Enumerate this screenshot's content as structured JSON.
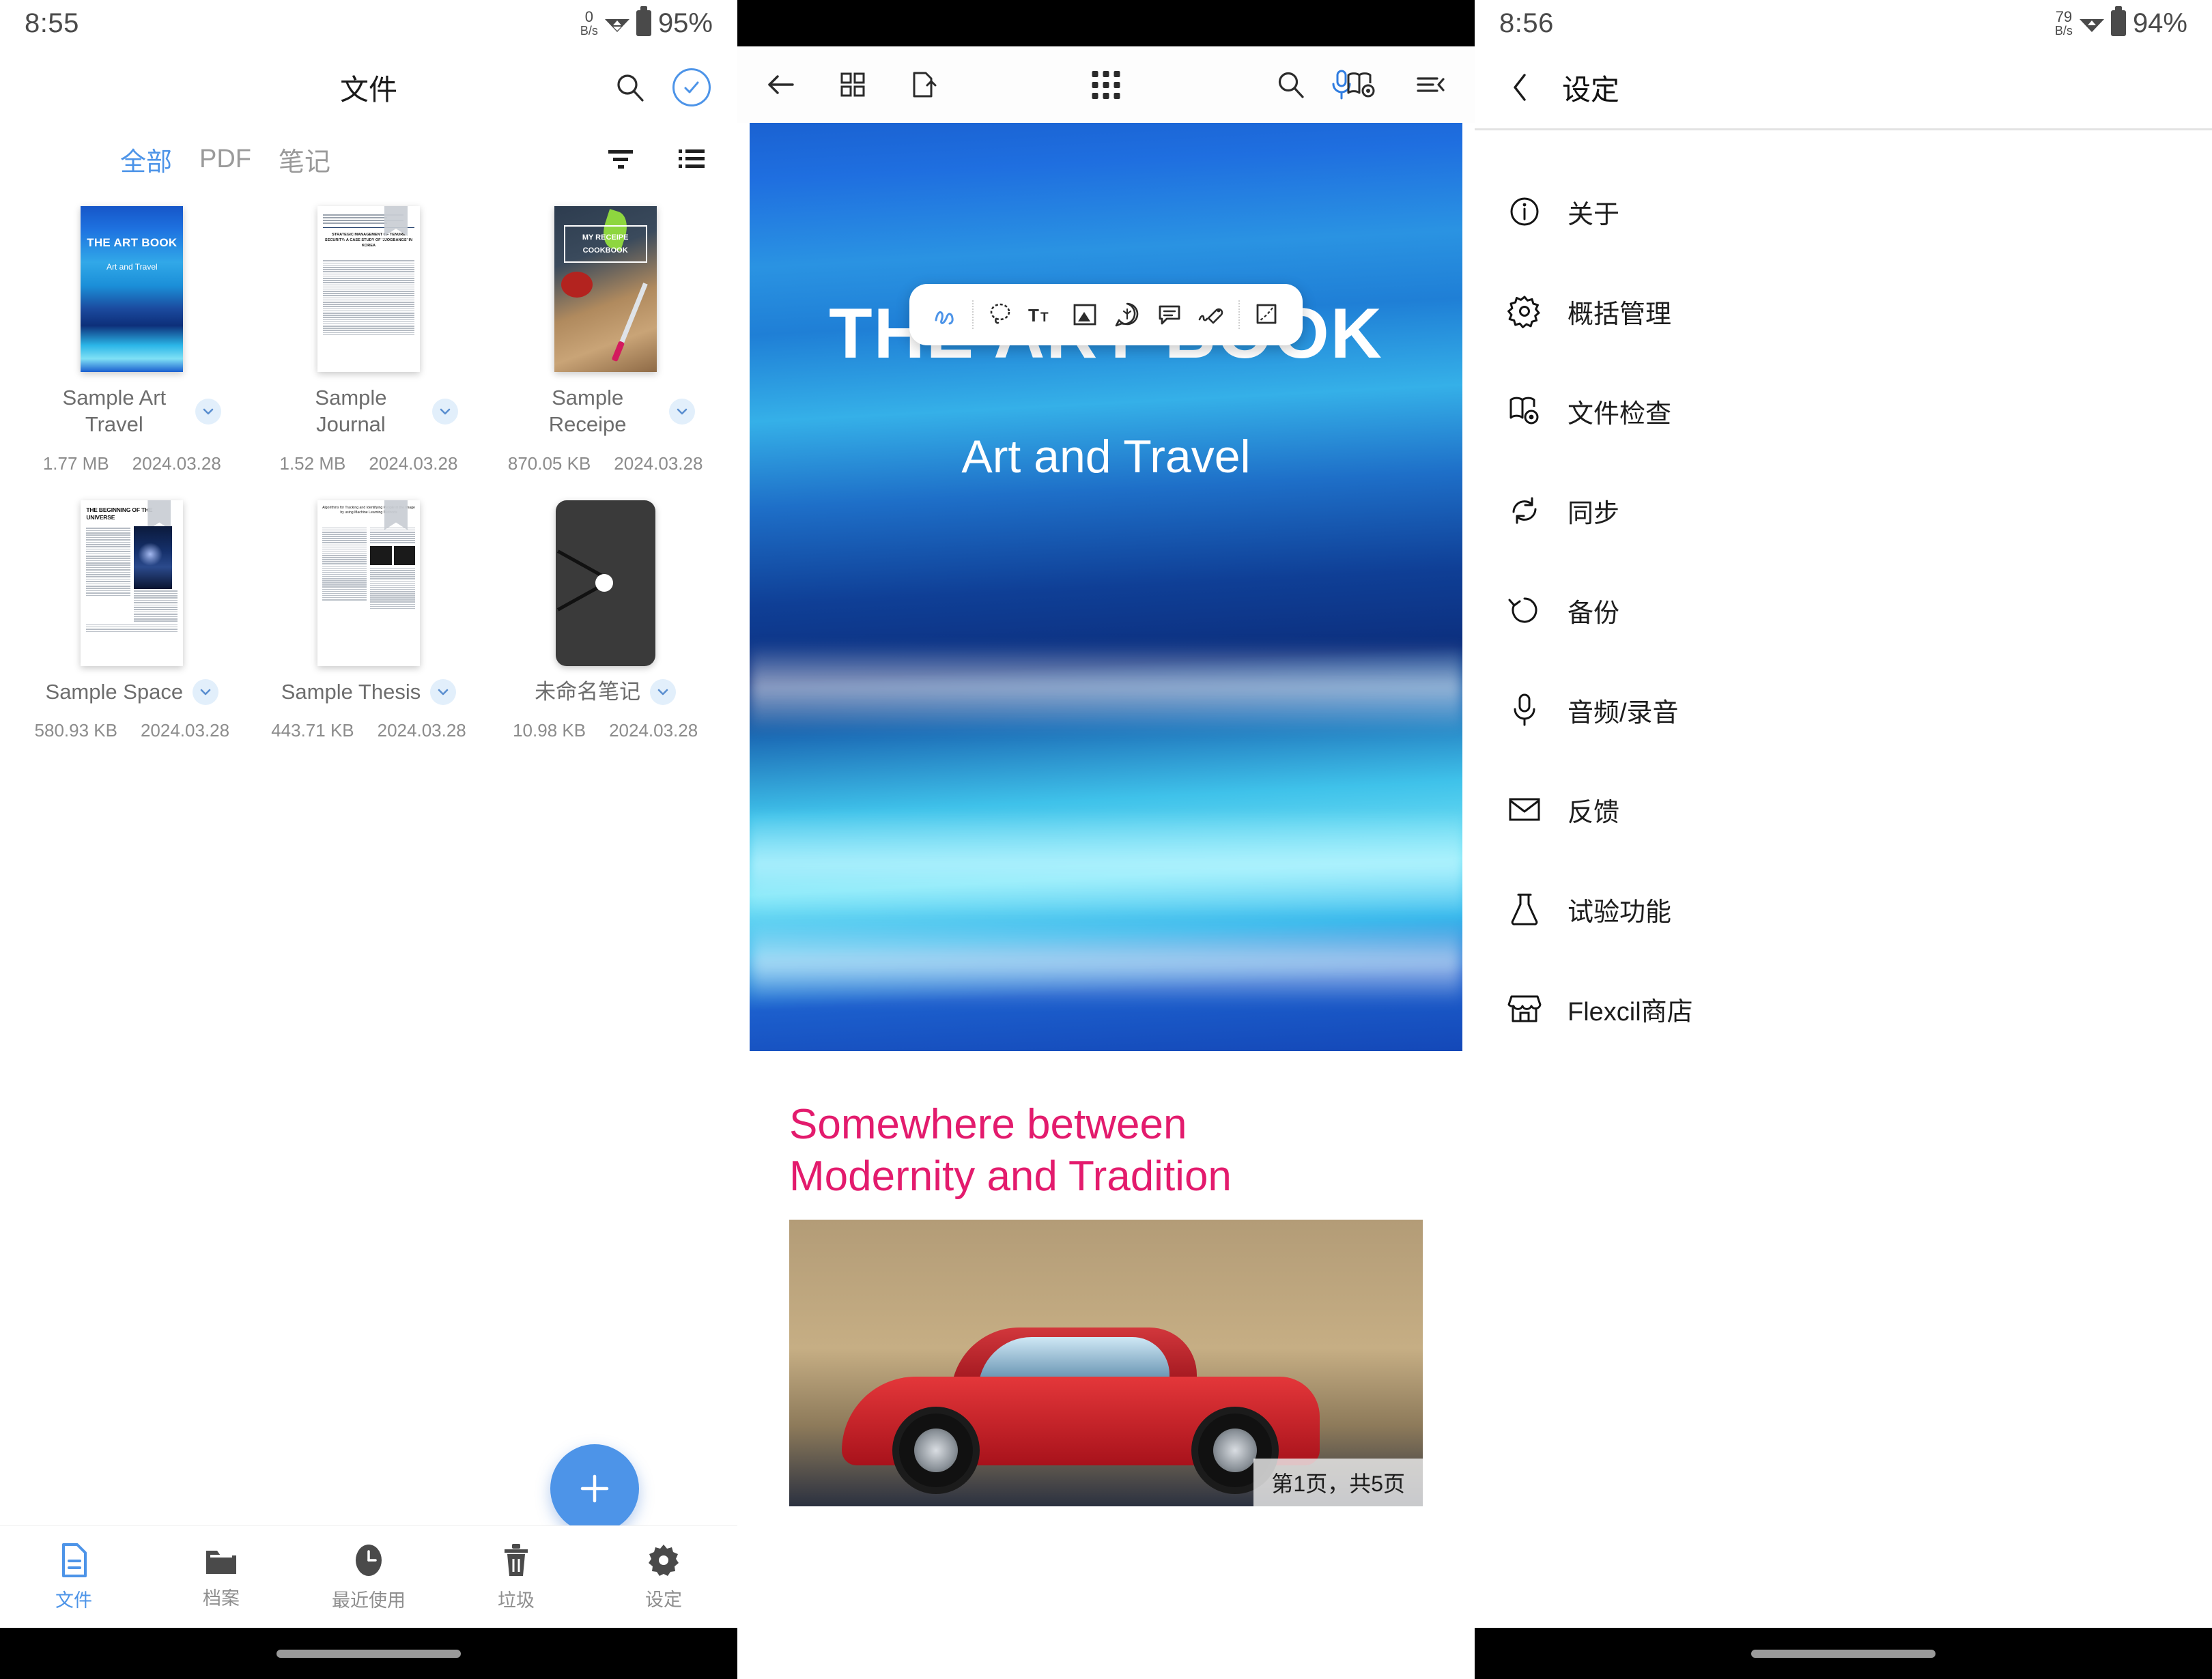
{
  "left_panel": {
    "status_bar": {
      "time": "8:55",
      "net_speed_value": "0",
      "net_speed_unit": "B/s",
      "battery": "95%"
    },
    "header": {
      "title": "文件",
      "search_icon": "search-icon",
      "select_icon": "check-circle-icon"
    },
    "tabs": [
      {
        "label": "全部",
        "active": true
      },
      {
        "label": "PDF",
        "active": false
      },
      {
        "label": "笔记",
        "active": false
      }
    ],
    "tab_actions": {
      "sort_icon": "sort-filter-icon",
      "view_icon": "list-view-icon"
    },
    "files": [
      {
        "name": "Sample Art Travel",
        "size": "1.77 MB",
        "date": "2024.03.28",
        "thumb": "art-book-cover",
        "thumb_title": "THE ART BOOK",
        "thumb_subtitle": "Art and Travel"
      },
      {
        "name": "Sample Journal",
        "size": "1.52 MB",
        "date": "2024.03.28",
        "thumb": "journal-paper",
        "thumb_title": "STRATEGIC MANAGEMENT OF TENURE SECURITY: A CASE STUDY OF 'JJOGBANGS' IN KOREA"
      },
      {
        "name": "Sample Receipe",
        "size": "870.05 KB",
        "date": "2024.03.28",
        "thumb": "cookbook-cover",
        "thumb_title": "MY RECEIPE",
        "thumb_subtitle": "COOKBOOK"
      },
      {
        "name": "Sample Space",
        "size": "580.93 KB",
        "date": "2024.03.28",
        "thumb": "space-article",
        "thumb_title": "THE BEGINNING OF THE UNIVERSE"
      },
      {
        "name": "Sample Thesis",
        "size": "443.71 KB",
        "date": "2024.03.28",
        "thumb": "thesis-paper",
        "thumb_title": "Algorithms for Tracking and Identifying People in the Image by using Machine Learning Methods"
      },
      {
        "name": "未命名笔记",
        "size": "10.98 KB",
        "date": "2024.03.28",
        "thumb": "dark-note",
        "thumb_title": "",
        "thumb_subtitle": ""
      }
    ],
    "fab": {
      "icon": "plus-icon"
    },
    "bottom_nav": [
      {
        "label": "文件",
        "icon": "document-icon",
        "active": true
      },
      {
        "label": "档案",
        "icon": "folder-icon",
        "active": false
      },
      {
        "label": "最近使用",
        "icon": "clock-icon",
        "active": false
      },
      {
        "label": "垃圾",
        "icon": "trash-icon",
        "active": false
      },
      {
        "label": "设定",
        "icon": "gear-icon",
        "active": false
      }
    ]
  },
  "middle_panel": {
    "toolbar": {
      "back_icon": "arrow-left-icon",
      "thumbnails_icon": "grid-view-icon",
      "export_icon": "file-upload-icon",
      "apps_icon": "apps-dots-icon",
      "mic_icon": "microphone-icon",
      "search_icon": "search-icon",
      "book_settings_icon": "book-gear-icon",
      "collapse_icon": "menu-collapse-icon"
    },
    "annotation_tools": [
      {
        "icon": "pen-scribble-icon",
        "active": true
      },
      {
        "icon": "lasso-select-icon",
        "active": false
      },
      {
        "icon": "text-format-icon",
        "active": false
      },
      {
        "icon": "image-insert-icon",
        "active": false
      },
      {
        "icon": "sticker-icon",
        "active": false
      },
      {
        "icon": "comment-icon",
        "active": false
      },
      {
        "icon": "signature-tag-icon",
        "active": false
      },
      {
        "icon": "shape-crop-icon",
        "active": false
      }
    ],
    "page1": {
      "title": "THE ART BOOK",
      "subtitle": "Art and Travel"
    },
    "page2": {
      "heading_line1": "Somewhere between",
      "heading_line2": "Modernity and Tradition"
    },
    "page_indicator": "第1页，共5页"
  },
  "right_panel": {
    "status_bar": {
      "time": "8:56",
      "net_speed_value": "79",
      "net_speed_unit": "B/s",
      "battery": "94%"
    },
    "header": {
      "title": "设定",
      "back_icon": "chevron-left-icon"
    },
    "settings": [
      {
        "label": "关于",
        "icon": "info-circle-icon"
      },
      {
        "label": "概括管理",
        "icon": "gear-icon"
      },
      {
        "label": "文件检查",
        "icon": "book-gear-icon"
      },
      {
        "label": "同步",
        "icon": "sync-icon"
      },
      {
        "label": "备份",
        "icon": "backup-restore-icon"
      },
      {
        "label": "音频/录音",
        "icon": "microphone-icon"
      },
      {
        "label": "反馈",
        "icon": "envelope-icon"
      },
      {
        "label": "试验功能",
        "icon": "flask-icon"
      },
      {
        "label": "Flexcil商店",
        "icon": "store-icon"
      }
    ]
  },
  "colors": {
    "accent": "#4d94e8",
    "heading_pink": "#e31b6d",
    "muted_text": "#8c8c8c"
  }
}
